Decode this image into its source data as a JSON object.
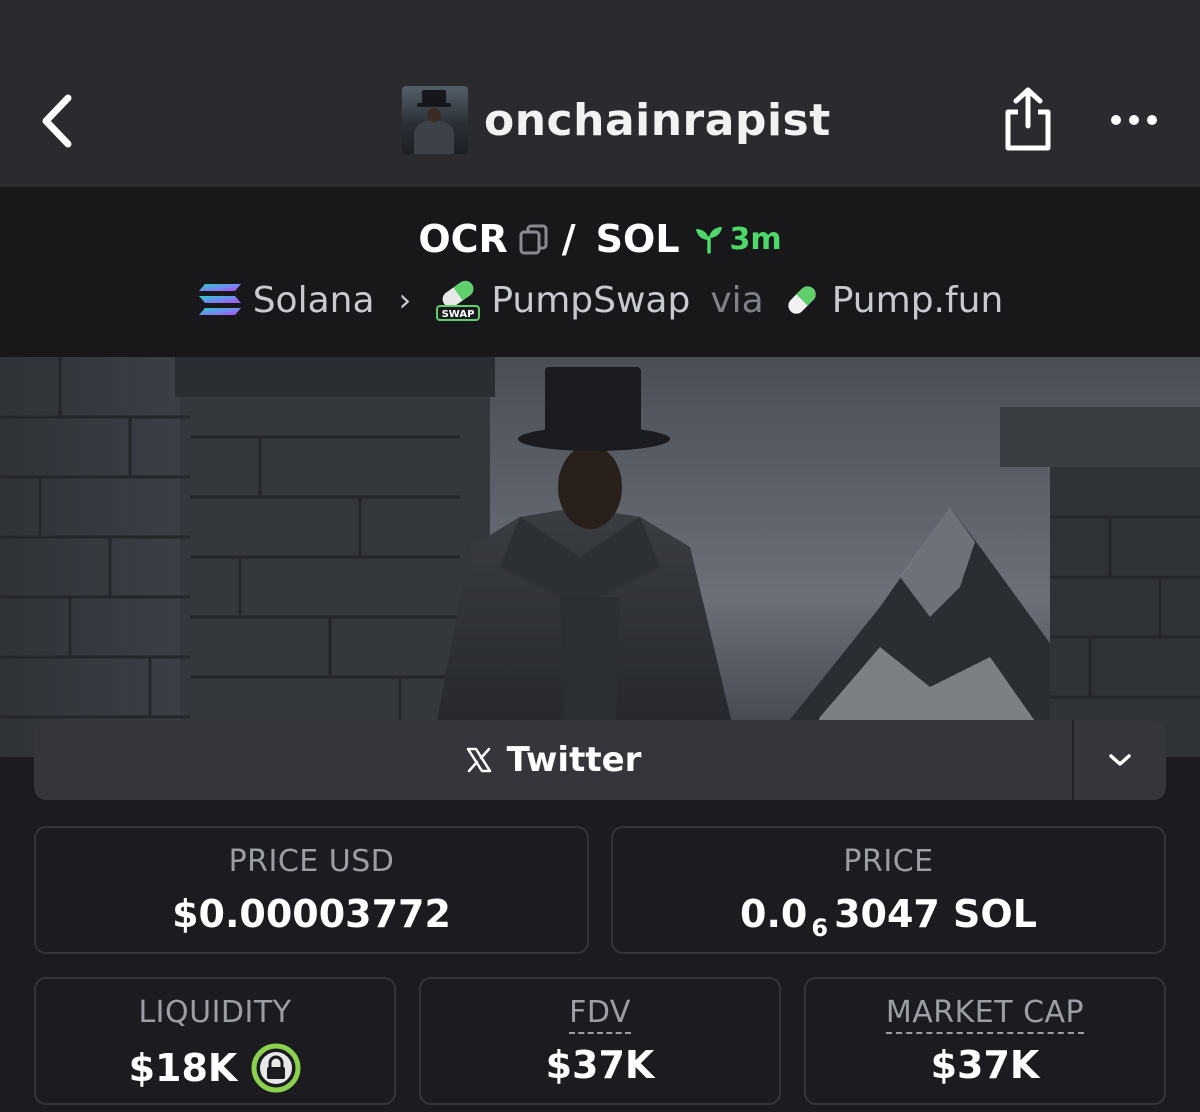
{
  "nav": {
    "username": "onchainrapist"
  },
  "pair": {
    "base": "OCR",
    "separator": "/",
    "quote": "SOL",
    "age": "3m"
  },
  "route": {
    "chain": "Solana",
    "dex": "PumpSwap",
    "swap_badge": "SWAP",
    "via": "via",
    "launchpad": "Pump.fun"
  },
  "social": {
    "twitter_label": "Twitter"
  },
  "stats": {
    "price_usd_label": "PRICE USD",
    "price_usd_value": "$0.00003772",
    "price_label": "PRICE",
    "price_prefix": "0.0",
    "price_zero_count": "6",
    "price_suffix": "3047 SOL",
    "liquidity_label": "LIQUIDITY",
    "liquidity_value": "$18K",
    "fdv_label": "FDV",
    "fdv_value": "$37K",
    "mcap_label": "MARKET CAP",
    "mcap_value": "$37K"
  },
  "colors": {
    "age_green": "#4ed86a",
    "lock_green": "#8bd14e",
    "background": "#1c1c20",
    "navbar": "#2a2a2f"
  },
  "icons": {
    "back": "chevron-left-icon",
    "share": "share-icon",
    "more": "ellipsis-icon",
    "copy": "copy-icon",
    "age": "sprout-icon",
    "chain": "solana-icon",
    "dex": "pumpswap-icon",
    "launchpad": "pill-icon",
    "twitter": "x-icon",
    "expand": "chevron-down-icon",
    "liquidity": "lock-icon"
  }
}
